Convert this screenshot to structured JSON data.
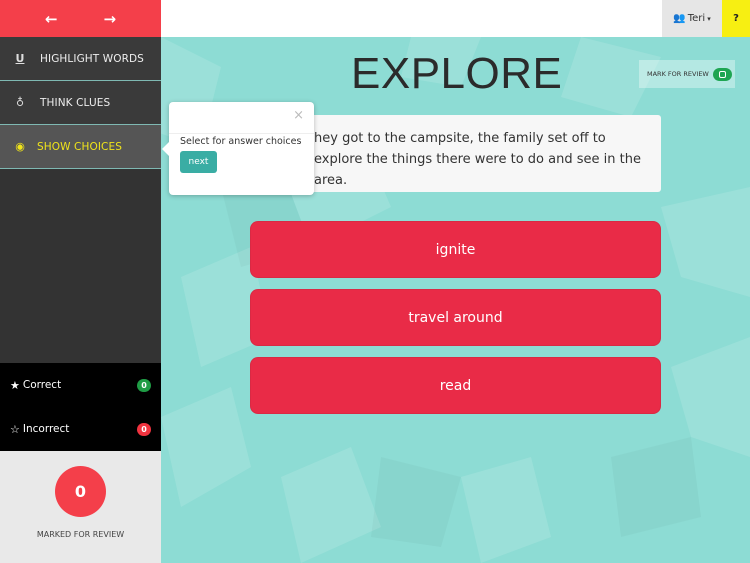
{
  "sidebar": {
    "nav": {
      "prev_icon": "←",
      "next_icon": "→"
    },
    "tools": [
      {
        "icon": "U",
        "icon_name": "underline-icon",
        "label": "HIGHLIGHT WORDS",
        "active": false
      },
      {
        "icon": "♁",
        "icon_name": "lightbulb-icon",
        "label": "THINK CLUES",
        "active": false
      },
      {
        "icon": "◉",
        "icon_name": "eye-icon",
        "label": "SHOW CHOICES",
        "active": true
      }
    ],
    "score": {
      "correct": {
        "icon": "★",
        "label": "Correct",
        "count": "0"
      },
      "incorrect": {
        "icon": "☆",
        "label": "Incorrect",
        "count": "0"
      }
    },
    "review": {
      "count": "0",
      "label": "MARKED FOR REVIEW"
    }
  },
  "topbar": {
    "user": {
      "icon": "👥",
      "name": "Teri",
      "caret": "▾"
    },
    "help_label": "?"
  },
  "main": {
    "word": "EXPLORE",
    "mark_review_label": "MARK FOR REVIEW",
    "sentence": "hey got to the campsite, the family set off to explore the things there were to do and see in the area.",
    "choices": [
      "ignite",
      "travel around",
      "read"
    ]
  },
  "popover": {
    "close_icon": "×",
    "text": "Select for answer choices",
    "next_label": "next"
  },
  "colors": {
    "accent_red": "#f43f4a",
    "choice_red": "#e92b47",
    "teal": "#3aada4",
    "active_yellow": "#f0e41a",
    "help_yellow": "#f7ef12",
    "correct_green": "#1f9c45"
  }
}
